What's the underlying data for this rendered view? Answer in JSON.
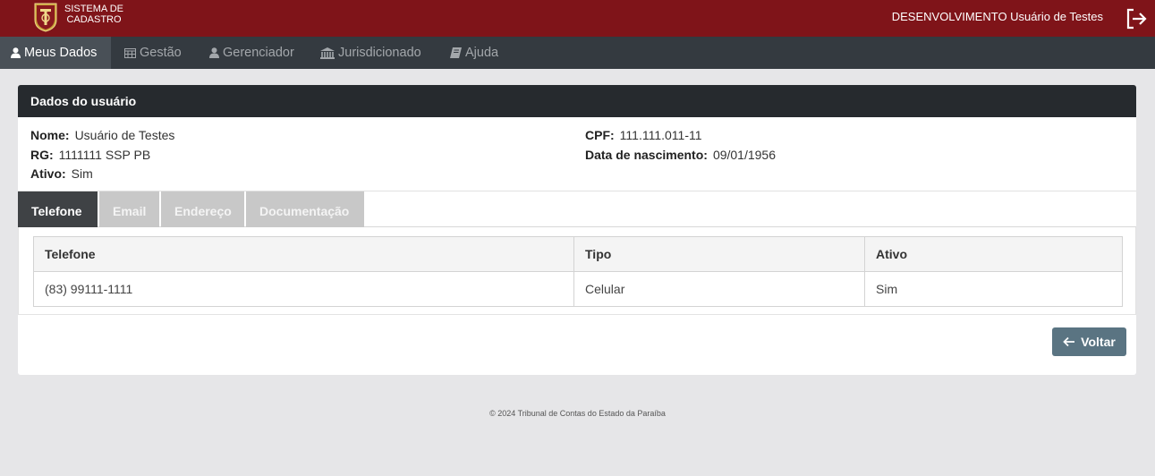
{
  "header": {
    "brand_line1": "SISTEMA DE",
    "brand_line2": "CADASTRO",
    "user_info": "DESENVOLVIMENTO Usuário de Testes",
    "logout_icon": "logout-icon"
  },
  "nav": {
    "items": [
      {
        "label": "Meus Dados",
        "icon": "user-icon",
        "active": true
      },
      {
        "label": "Gestão",
        "icon": "calendar-icon",
        "active": false
      },
      {
        "label": "Gerenciador",
        "icon": "user-icon",
        "active": false
      },
      {
        "label": "Jurisdicionado",
        "icon": "institution-icon",
        "active": false
      },
      {
        "label": "Ajuda",
        "icon": "book-icon",
        "active": false
      }
    ]
  },
  "card": {
    "title": "Dados do usuário",
    "fields": {
      "nome_label": "Nome:",
      "nome_value": "Usuário de Testes",
      "rg_label": "RG:",
      "rg_value": "1111111 SSP PB",
      "ativo_label": "Ativo:",
      "ativo_value": "Sim",
      "cpf_label": "CPF:",
      "cpf_value": "111.111.011-11",
      "nasc_label": "Data de nascimento:",
      "nasc_value": "09/01/1956"
    },
    "tabs": [
      {
        "label": "Telefone",
        "active": true
      },
      {
        "label": "Email",
        "active": false
      },
      {
        "label": "Endereço",
        "active": false
      },
      {
        "label": "Documentação",
        "active": false
      }
    ],
    "table": {
      "headers": [
        "Telefone",
        "Tipo",
        "Ativo"
      ],
      "rows": [
        [
          "(83) 99111-1111",
          "Celular",
          "Sim"
        ]
      ]
    },
    "back_button": "Voltar"
  },
  "footer": {
    "text": "© 2024 Tribunal de Contas do Estado da Paraíba"
  },
  "colors": {
    "header_bg": "#7f1419",
    "nav_bg": "#343a40",
    "card_header_bg": "#262a2e",
    "button_bg": "#5a7482"
  }
}
